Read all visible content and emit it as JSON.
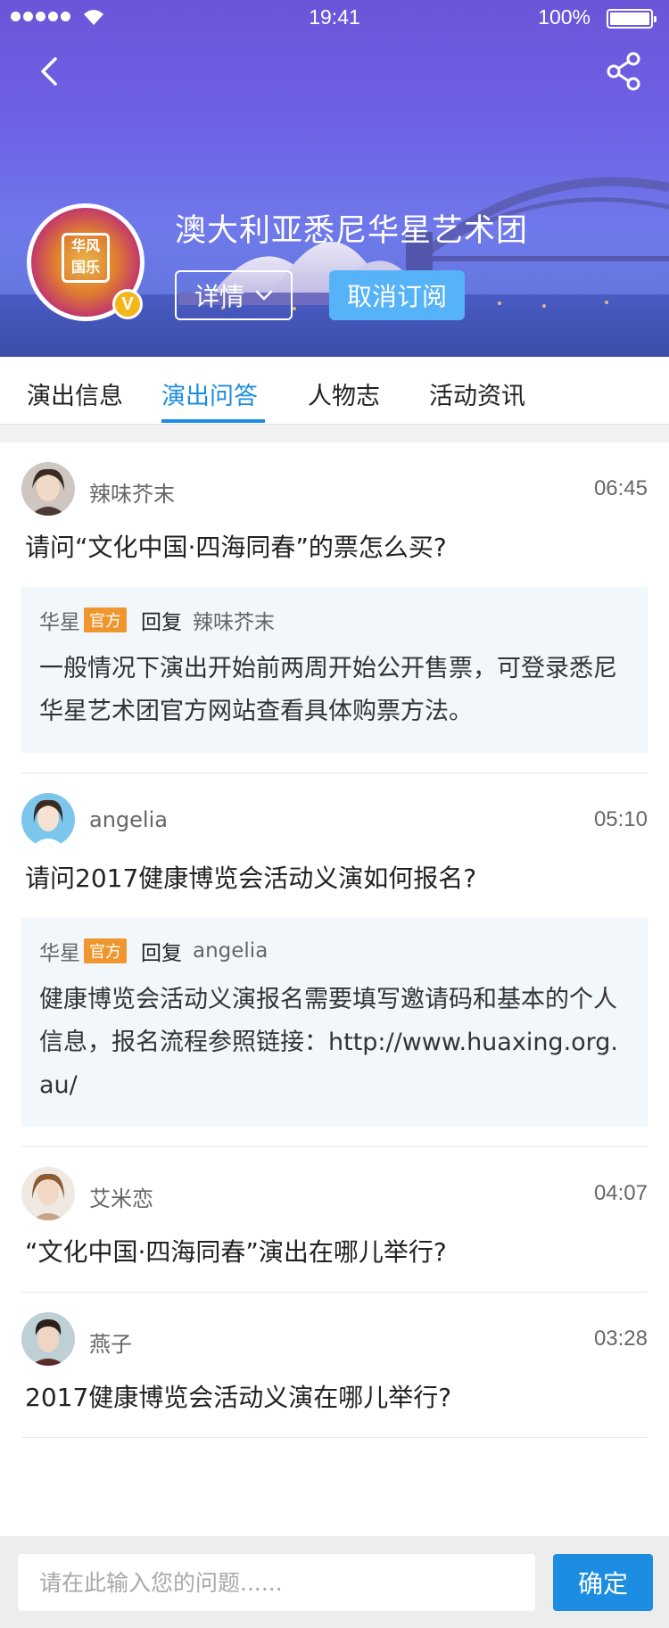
{
  "status_bar": {
    "time": "19:41",
    "battery": "100%"
  },
  "header": {
    "org_name": "澳大利亚悉尼华星艺术团",
    "avatar_seal_text": "华风\n国乐",
    "verified_badge": "V",
    "detail_label": "详情",
    "unsubscribe_label": "取消订阅"
  },
  "tabs": [
    {
      "label": "演出信息",
      "active": false
    },
    {
      "label": "演出问答",
      "active": true
    },
    {
      "label": "人物志",
      "active": false
    },
    {
      "label": "活动资讯",
      "active": false
    }
  ],
  "questions": [
    {
      "user": "辣味芥末",
      "time": "06:45",
      "question": "请问“文化中国·四海同春”的票怎么买?",
      "reply": {
        "from": "华星",
        "badge": "官方",
        "reply_word": "回复",
        "to": "辣味芥末",
        "text": "一般情况下演出开始前两周开始公开售票，可登录悉尼华星艺术团官方网站查看具体购票方法。"
      }
    },
    {
      "user": "angelia",
      "time": "05:10",
      "question": "请问2017健康博览会活动义演如何报名?",
      "reply": {
        "from": "华星",
        "badge": "官方",
        "reply_word": "回复",
        "to": "angelia",
        "text": "健康博览会活动义演报名需要填写邀请码和基本的个人信息，报名流程参照链接：http://www.huaxing.org.au/"
      }
    },
    {
      "user": "艾米恋",
      "time": "04:07",
      "question": "“文化中国·四海同春”演出在哪儿举行?"
    },
    {
      "user": "燕子",
      "time": "03:28",
      "question": "2017健康博览会活动义演在哪儿举行?"
    }
  ],
  "bottom": {
    "input_placeholder": "请在此输入您的问题......",
    "confirm_label": "确定"
  },
  "colors": {
    "accent": "#1c8de0",
    "official_badge": "#f0962e",
    "unsubscribe_bg": "#56b3f7",
    "verified": "#f5b619"
  },
  "icons": {
    "back": "chevron-left-icon",
    "share": "share-icon",
    "detail_arrow": "chevron-down-icon"
  }
}
